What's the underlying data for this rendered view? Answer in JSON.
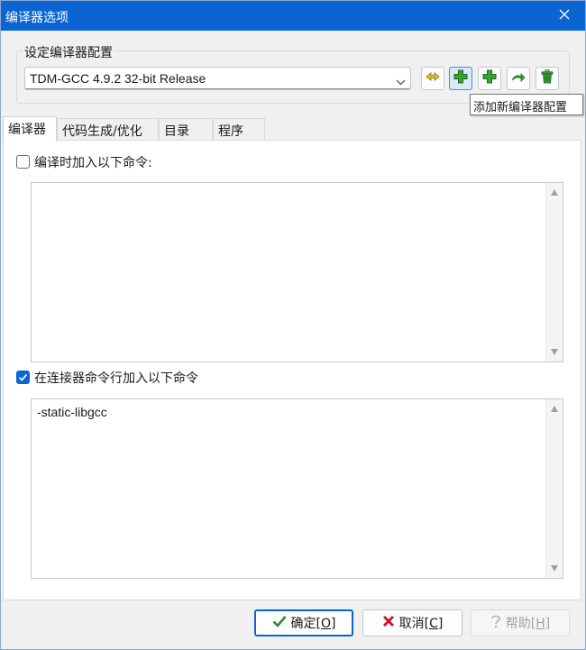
{
  "window": {
    "title": "编译器选项"
  },
  "config": {
    "group_label": "设定编译器配置",
    "selected": "TDM-GCC 4.9.2 32-bit Release",
    "toolbar": [
      {
        "name": "compiler-setting-icon"
      },
      {
        "name": "add-blank-compiler-icon"
      },
      {
        "name": "add-compiler-icon"
      },
      {
        "name": "rename-compiler-icon"
      },
      {
        "name": "delete-compiler-icon"
      }
    ],
    "tooltip": "添加新编译器配置"
  },
  "tabs": [
    {
      "label": "编译器",
      "active": true
    },
    {
      "label": "代码生成/优化",
      "active": false
    },
    {
      "label": "目录",
      "active": false
    },
    {
      "label": "程序",
      "active": false
    }
  ],
  "compiler_tab": {
    "compile_cmd": {
      "label": "编译时加入以下命令:",
      "checked": false,
      "value": ""
    },
    "linker_cmd": {
      "label": "在连接器命令行加入以下命令",
      "checked": true,
      "value": "-static-libgcc"
    }
  },
  "buttons": {
    "ok": {
      "label": "确定",
      "accel": "[O]"
    },
    "cancel": {
      "label": "取消",
      "accel": "[C]"
    },
    "help": {
      "label": "帮助",
      "accel": "[H]"
    }
  },
  "colors": {
    "accent": "#0a64d2",
    "ok_check": "#2e8b2e",
    "cancel_x": "#c8102e",
    "plus_green": "#33a532"
  }
}
